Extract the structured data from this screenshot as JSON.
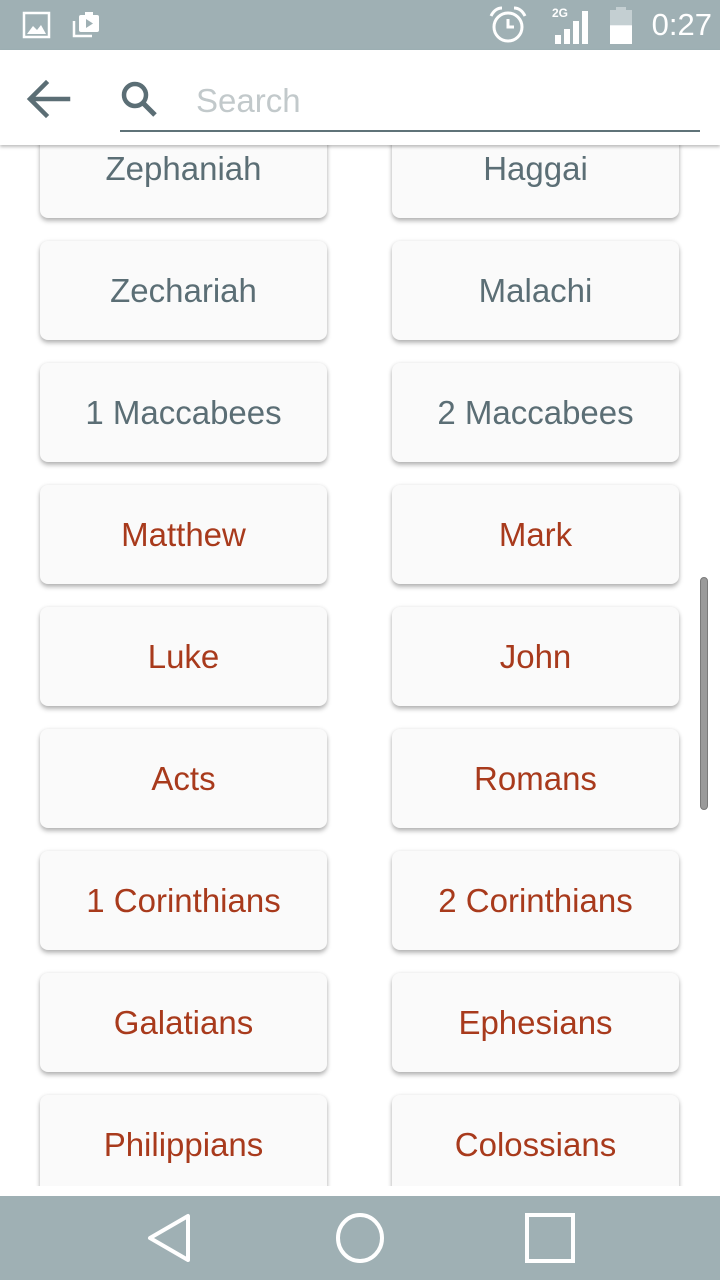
{
  "status_bar": {
    "time": "0:27",
    "network": "2G",
    "battery_level_percent": 55,
    "icons": [
      "gallery-icon",
      "media-notification-icon",
      "alarm-icon",
      "signal-icon",
      "battery-icon"
    ]
  },
  "header": {
    "back_icon": "arrow-left-icon",
    "search_icon": "search-icon",
    "search_placeholder": "Search",
    "search_value": ""
  },
  "colors": {
    "old_testament_text": "#5b6e75",
    "new_testament_text": "#a83a1c",
    "bar_background": "#9fb0b4"
  },
  "books": [
    {
      "name": "Zephaniah",
      "testament": "ot"
    },
    {
      "name": "Haggai",
      "testament": "ot"
    },
    {
      "name": "Zechariah",
      "testament": "ot"
    },
    {
      "name": "Malachi",
      "testament": "ot"
    },
    {
      "name": "1 Maccabees",
      "testament": "ot"
    },
    {
      "name": "2 Maccabees",
      "testament": "ot"
    },
    {
      "name": "Matthew",
      "testament": "nt"
    },
    {
      "name": "Mark",
      "testament": "nt"
    },
    {
      "name": "Luke",
      "testament": "nt"
    },
    {
      "name": "John",
      "testament": "nt"
    },
    {
      "name": "Acts",
      "testament": "nt"
    },
    {
      "name": "Romans",
      "testament": "nt"
    },
    {
      "name": "1 Corinthians",
      "testament": "nt"
    },
    {
      "name": "2 Corinthians",
      "testament": "nt"
    },
    {
      "name": "Galatians",
      "testament": "nt"
    },
    {
      "name": "Ephesians",
      "testament": "nt"
    },
    {
      "name": "Philippians",
      "testament": "nt"
    },
    {
      "name": "Colossians",
      "testament": "nt"
    }
  ],
  "nav_bar": {
    "buttons": [
      "back-triangle-icon",
      "home-circle-icon",
      "recents-square-icon"
    ]
  }
}
